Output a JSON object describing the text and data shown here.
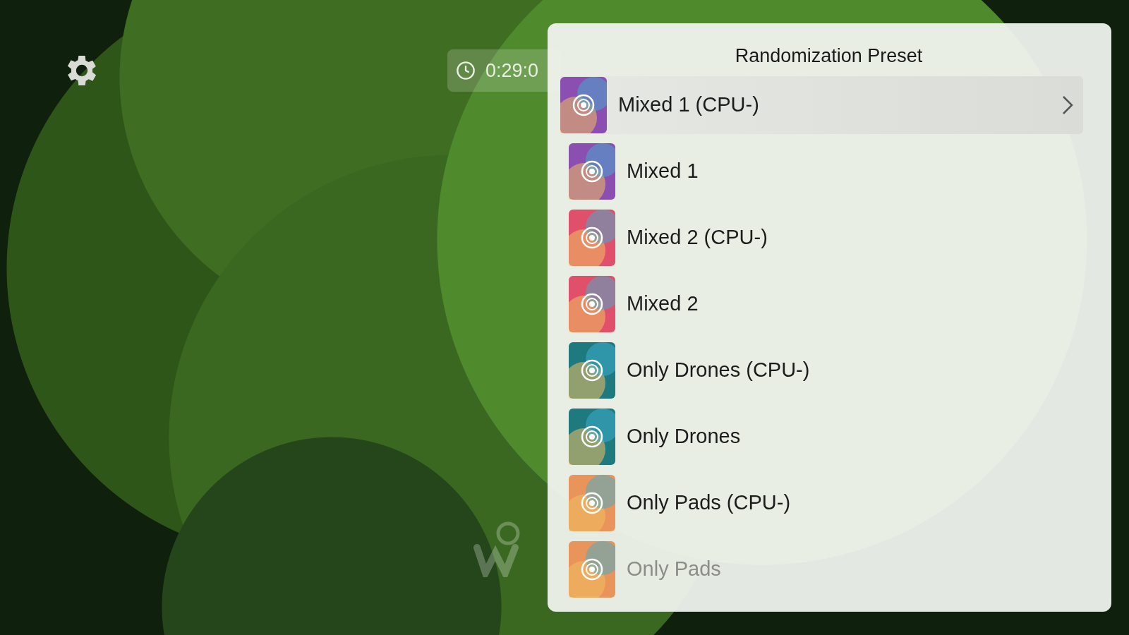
{
  "timer": {
    "elapsed": "0:29:0"
  },
  "preset_menu": {
    "title": "Randomization Preset",
    "items": [
      {
        "label": "Mixed 1 (CPU-)",
        "selected": true,
        "color": "#8a4fb0"
      },
      {
        "label": "Mixed 1",
        "selected": false,
        "color": "#8a4fb0"
      },
      {
        "label": "Mixed 2 (CPU-)",
        "selected": false,
        "color": "#e0506a"
      },
      {
        "label": "Mixed 2",
        "selected": false,
        "color": "#e0506a"
      },
      {
        "label": "Only Drones (CPU-)",
        "selected": false,
        "color": "#1f7a80"
      },
      {
        "label": "Only Drones",
        "selected": false,
        "color": "#1f7a80"
      },
      {
        "label": "Only Pads (CPU-)",
        "selected": false,
        "color": "#e8945a"
      },
      {
        "label": "Only Pads",
        "selected": false,
        "color": "#e8945a"
      }
    ]
  }
}
